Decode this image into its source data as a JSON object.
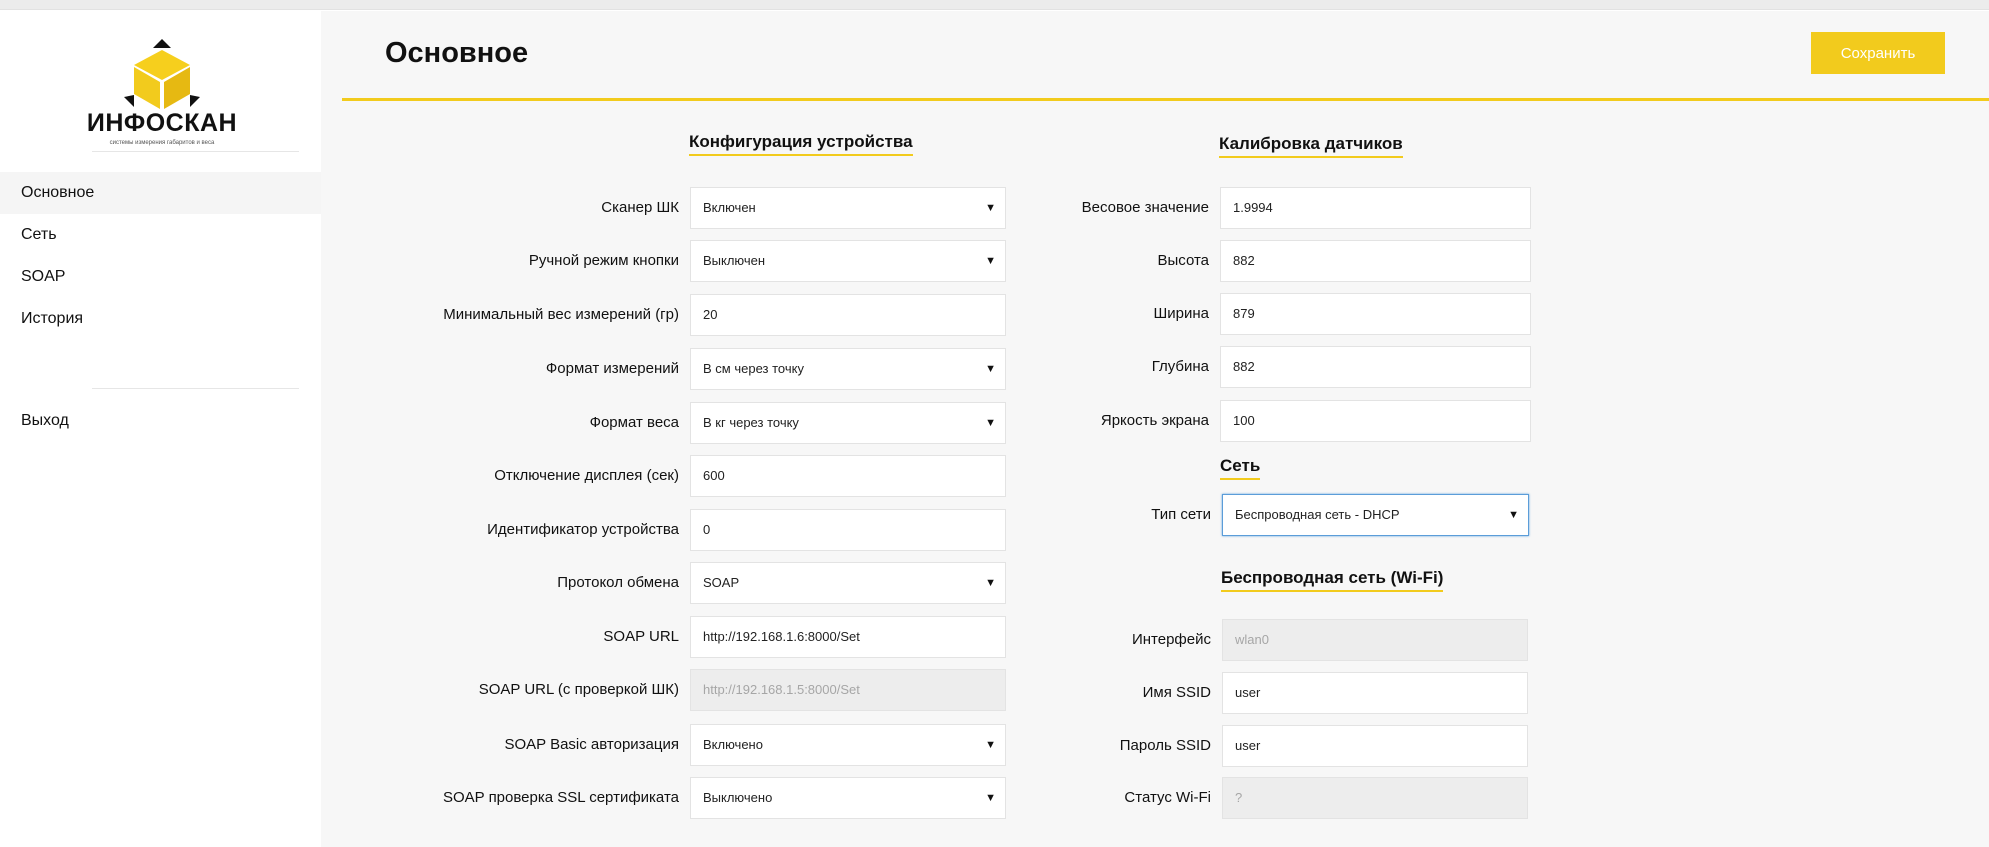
{
  "brand": {
    "name": "ИНФОСКАН",
    "tagline": "системы измерения габаритов и веса",
    "color": "#f2cb1d"
  },
  "sidebar": {
    "items": [
      {
        "label": "Основное",
        "active": true
      },
      {
        "label": "Сеть",
        "active": false
      },
      {
        "label": "SOAP",
        "active": false
      },
      {
        "label": "История",
        "active": false
      }
    ],
    "exit_label": "Выход"
  },
  "header": {
    "title": "Основное",
    "save_label": "Сохранить"
  },
  "device_config": {
    "title": "Конфигурация устройства",
    "fields": [
      {
        "label": "Сканер ШК",
        "value": "Включен",
        "type": "select"
      },
      {
        "label": "Ручной режим кнопки",
        "value": "Выключен",
        "type": "select"
      },
      {
        "label": "Минимальный вес измерений (гр)",
        "value": "20",
        "type": "input"
      },
      {
        "label": "Формат измерений",
        "value": "В см через точку",
        "type": "select"
      },
      {
        "label": "Формат веса",
        "value": "В кг через точку",
        "type": "select"
      },
      {
        "label": "Отключение дисплея (сек)",
        "value": "600",
        "type": "input"
      },
      {
        "label": "Идентификатор устройства",
        "value": "0",
        "type": "input"
      },
      {
        "label": "Протокол обмена",
        "value": "SOAP",
        "type": "select"
      },
      {
        "label": "SOAP URL",
        "value": "http://192.168.1.6:8000/Set",
        "type": "input"
      },
      {
        "label": "SOAP URL (с проверкой ШК)",
        "value": "http://192.168.1.5:8000/Set",
        "type": "disabled"
      },
      {
        "label": "SOAP Basic авторизация",
        "value": "Включено",
        "type": "select"
      },
      {
        "label": "SOAP проверка SSL сертификата",
        "value": "Выключено",
        "type": "select"
      }
    ]
  },
  "calibration": {
    "title": "Калибровка датчиков",
    "fields": [
      {
        "label": "Весовое значение",
        "value": "1.9994"
      },
      {
        "label": "Высота",
        "value": "882"
      },
      {
        "label": "Ширина",
        "value": "879"
      },
      {
        "label": "Глубина",
        "value": "882"
      },
      {
        "label": "Яркость экрана",
        "value": "100"
      }
    ]
  },
  "network": {
    "title": "Сеть",
    "type_label": "Тип сети",
    "type_value": "Беспроводная сеть - DHCP"
  },
  "wifi": {
    "title": "Беспроводная сеть (Wi-Fi)",
    "fields": [
      {
        "label": "Интерфейс",
        "value": "wlan0",
        "type": "disabled"
      },
      {
        "label": "Имя SSID",
        "value": "user",
        "type": "input"
      },
      {
        "label": "Пароль SSID",
        "value": "user",
        "type": "input"
      },
      {
        "label": "Статус Wi-Fi",
        "value": "?",
        "type": "disabled"
      }
    ]
  }
}
